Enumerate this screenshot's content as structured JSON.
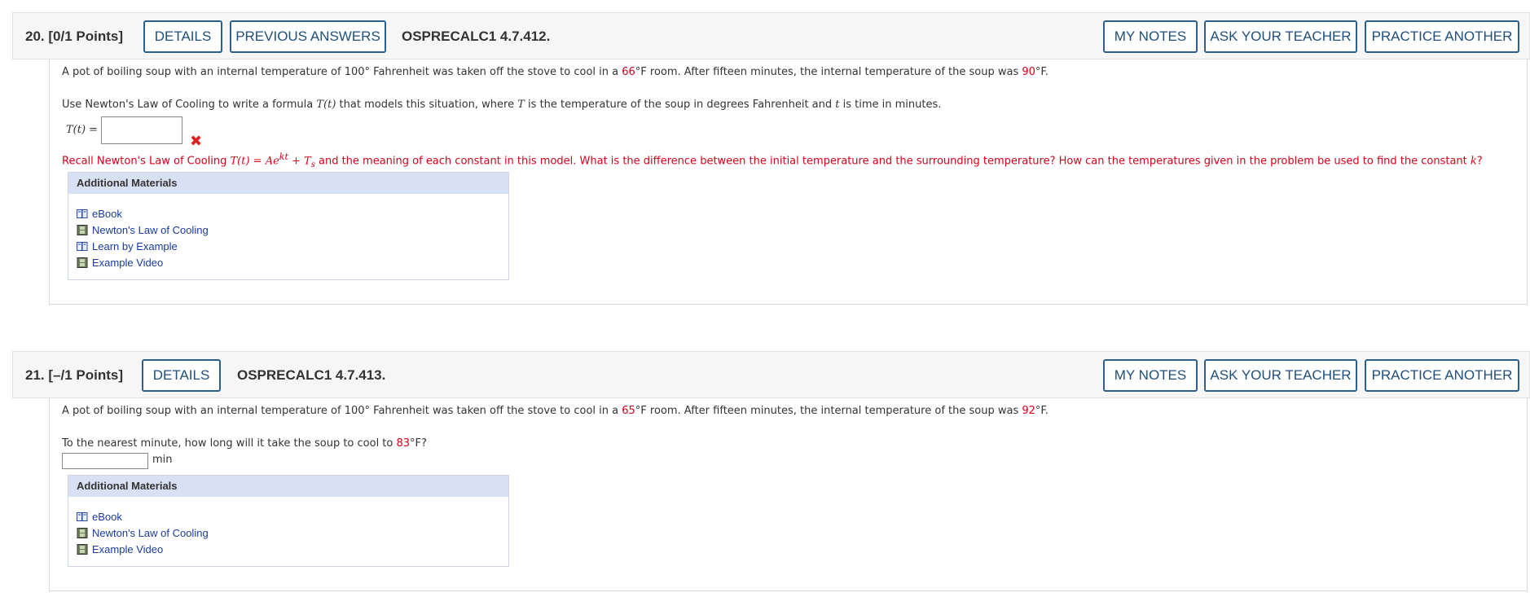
{
  "questions": [
    {
      "number": "20.",
      "points": "[0/1 Points]",
      "buttons": {
        "details": "DETAILS",
        "previous_answers": "PREVIOUS ANSWERS"
      },
      "code": "OSPRECALC1 4.7.412.",
      "right_buttons": {
        "my_notes": "MY NOTES",
        "ask_teacher": "ASK YOUR TEACHER",
        "practice": "PRACTICE ANOTHER"
      },
      "line1": {
        "a": "A pot of boiling soup with an internal temperature of 100° Fahrenheit was taken off the stove to cool in a ",
        "room_temp": "66",
        "b": "°F room. After fifteen minutes, the internal temperature of the soup was ",
        "final_temp": "90",
        "c": "°F."
      },
      "line2": {
        "a": "Use Newton's Law of Cooling to write a formula ",
        "func": "T(t)",
        "b": "  that models this situation, where ",
        "T": "T",
        "c": " is the temperature of the soup in degrees Fahrenheit and ",
        "t": "t",
        "d": " is time in minutes."
      },
      "answer_label": "T(t) =",
      "answer_value": "",
      "answer_status": "incorrect",
      "hint": {
        "a": "Recall Newton's Law of Cooling  ",
        "formula_lhs": "T(t) = Ae",
        "formula_exp": "kt",
        "formula_plus": " + T",
        "formula_sub": "s",
        "b": "  and the meaning of each constant in this model. What is the difference between the initial temperature and the surrounding temperature? How can the temperatures given in the problem be used to find the constant ",
        "k": "k",
        "c": "?"
      },
      "additional_materials": {
        "title": "Additional Materials",
        "items": [
          {
            "label": "eBook",
            "icon": "book-icon"
          },
          {
            "label": "Newton's Law of Cooling",
            "icon": "film-icon"
          },
          {
            "label": "Learn by Example",
            "icon": "book-icon"
          },
          {
            "label": "Example Video",
            "icon": "film-icon"
          }
        ]
      }
    },
    {
      "number": "21.",
      "points": "[–/1 Points]",
      "buttons": {
        "details": "DETAILS"
      },
      "code": "OSPRECALC1 4.7.413.",
      "right_buttons": {
        "my_notes": "MY NOTES",
        "ask_teacher": "ASK YOUR TEACHER",
        "practice": "PRACTICE ANOTHER"
      },
      "line1": {
        "a": "A pot of boiling soup with an internal temperature of 100° Fahrenheit was taken off the stove to cool in a ",
        "room_temp": "65",
        "b": "°F room. After fifteen minutes, the internal temperature of the soup was ",
        "final_temp": "92",
        "c": "°F."
      },
      "line2": {
        "a": "To the nearest minute, how long will it take the soup to cool to ",
        "target": "83",
        "b": "°F?"
      },
      "answer_value": "",
      "answer_unit": "min",
      "additional_materials": {
        "title": "Additional Materials",
        "items": [
          {
            "label": "eBook",
            "icon": "book-icon"
          },
          {
            "label": "Newton's Law of Cooling",
            "icon": "film-icon"
          },
          {
            "label": "Example Video",
            "icon": "film-icon"
          }
        ]
      }
    }
  ],
  "colors": {
    "button_border": "#2b5f8c",
    "highlight_red": "#d0021b",
    "materials_header": "#d8e0f4",
    "link": "#1a3b9c"
  }
}
